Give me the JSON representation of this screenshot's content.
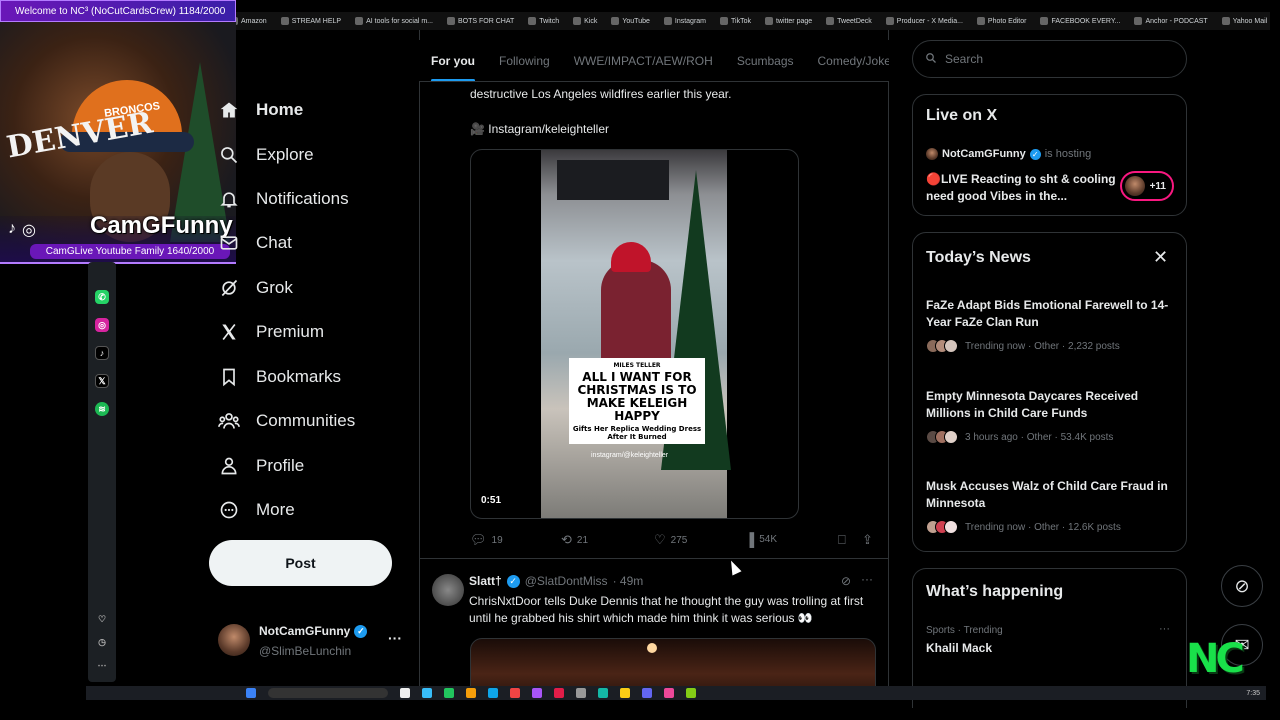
{
  "overlay": {
    "welcome": "Welcome to NC³ (NoCutCardsCrew) 1184/2000",
    "streamer_name": "CamGFunny",
    "family_counter": "CamGLive Youtube Family 1640/2000",
    "webcam_text": "DENVER",
    "hat_text": "BRONCOS"
  },
  "bookmarks": [
    "Amazon",
    "STREAM HELP",
    "AI tools for social m...",
    "BOTS FOR CHAT",
    "Twitch",
    "Kick",
    "YouTube",
    "Instagram",
    "TikTok",
    "twitter page",
    "TweetDeck",
    "Producer - X Media...",
    "Photo Editor",
    "FACEBOOK EVERY...",
    "Anchor - PODCAST",
    "Yahoo Mail"
  ],
  "nav": {
    "items": [
      {
        "label": "Home",
        "icon": "home-icon"
      },
      {
        "label": "Explore",
        "icon": "search-icon"
      },
      {
        "label": "Notifications",
        "icon": "bell-icon"
      },
      {
        "label": "Chat",
        "icon": "mail-icon"
      },
      {
        "label": "Grok",
        "icon": "grok-icon"
      },
      {
        "label": "Premium",
        "icon": "x-logo-icon"
      },
      {
        "label": "Bookmarks",
        "icon": "bookmark-icon"
      },
      {
        "label": "Communities",
        "icon": "communities-icon"
      },
      {
        "label": "Profile",
        "icon": "person-icon"
      },
      {
        "label": "More",
        "icon": "more-circle-icon"
      }
    ],
    "post_label": "Post"
  },
  "account": {
    "name": "NotCamGFunny",
    "handle": "@SlimBeLunchin",
    "more": "···"
  },
  "tabs": [
    "For you",
    "Following",
    "WWE/IMPACT/AEW/ROH",
    "Scumbags",
    "Comedy/Joke"
  ],
  "tweet1": {
    "text_tail": "destructive Los Angeles wildfires earlier this year.",
    "source": "🎥 Instagram/keleighteller",
    "video": {
      "duration": "0:51",
      "card_kicker": "MILES TELLER",
      "card_headline": "ALL I WANT FOR CHRISTMAS IS TO MAKE KELEIGH HAPPY",
      "card_sub": "Gifts Her Replica Wedding Dress After It Burned",
      "card_handle": "instagram/@keleighteller"
    },
    "replies": "19",
    "reposts": "21",
    "likes": "275",
    "views": "54K"
  },
  "tweet2": {
    "author": "Slatt†",
    "handle": "@SlatDontMiss",
    "time": "· 49m",
    "text": "ChrisNxtDoor tells Duke Dennis that he thought the guy was trolling at first until he grabbed his shirt which made him think it was serious 👀"
  },
  "search": {
    "placeholder": "Search"
  },
  "live": {
    "title": "Live on X",
    "host": "NotCamGFunny",
    "hosting": "is hosting",
    "stream_title": "🔴LIVE Reacting to sht & cooling need good Vibes in the...",
    "listeners": "+11"
  },
  "news": {
    "title": "Today’s News",
    "items": [
      {
        "headline": "FaZe Adapt Bids Emotional Farewell to 14-Year FaZe Clan Run",
        "meta": "Trending now · Other · 2,232 posts"
      },
      {
        "headline": "Empty Minnesota Daycares Received Millions in Child Care Funds",
        "meta": "3 hours ago · Other · 53.4K posts"
      },
      {
        "headline": "Musk Accuses Walz of Child Care Fraud in Minnesota",
        "meta": "Trending now · Other · 12.6K posts"
      }
    ]
  },
  "happening": {
    "title": "What’s happening",
    "category": "Sports · Trending",
    "topic": "Khalil Mack"
  },
  "brand": {
    "nc_logo": "NC",
    "accent": "#1d9bf0",
    "verified": "#1d9bf0"
  },
  "clock": "7:35"
}
